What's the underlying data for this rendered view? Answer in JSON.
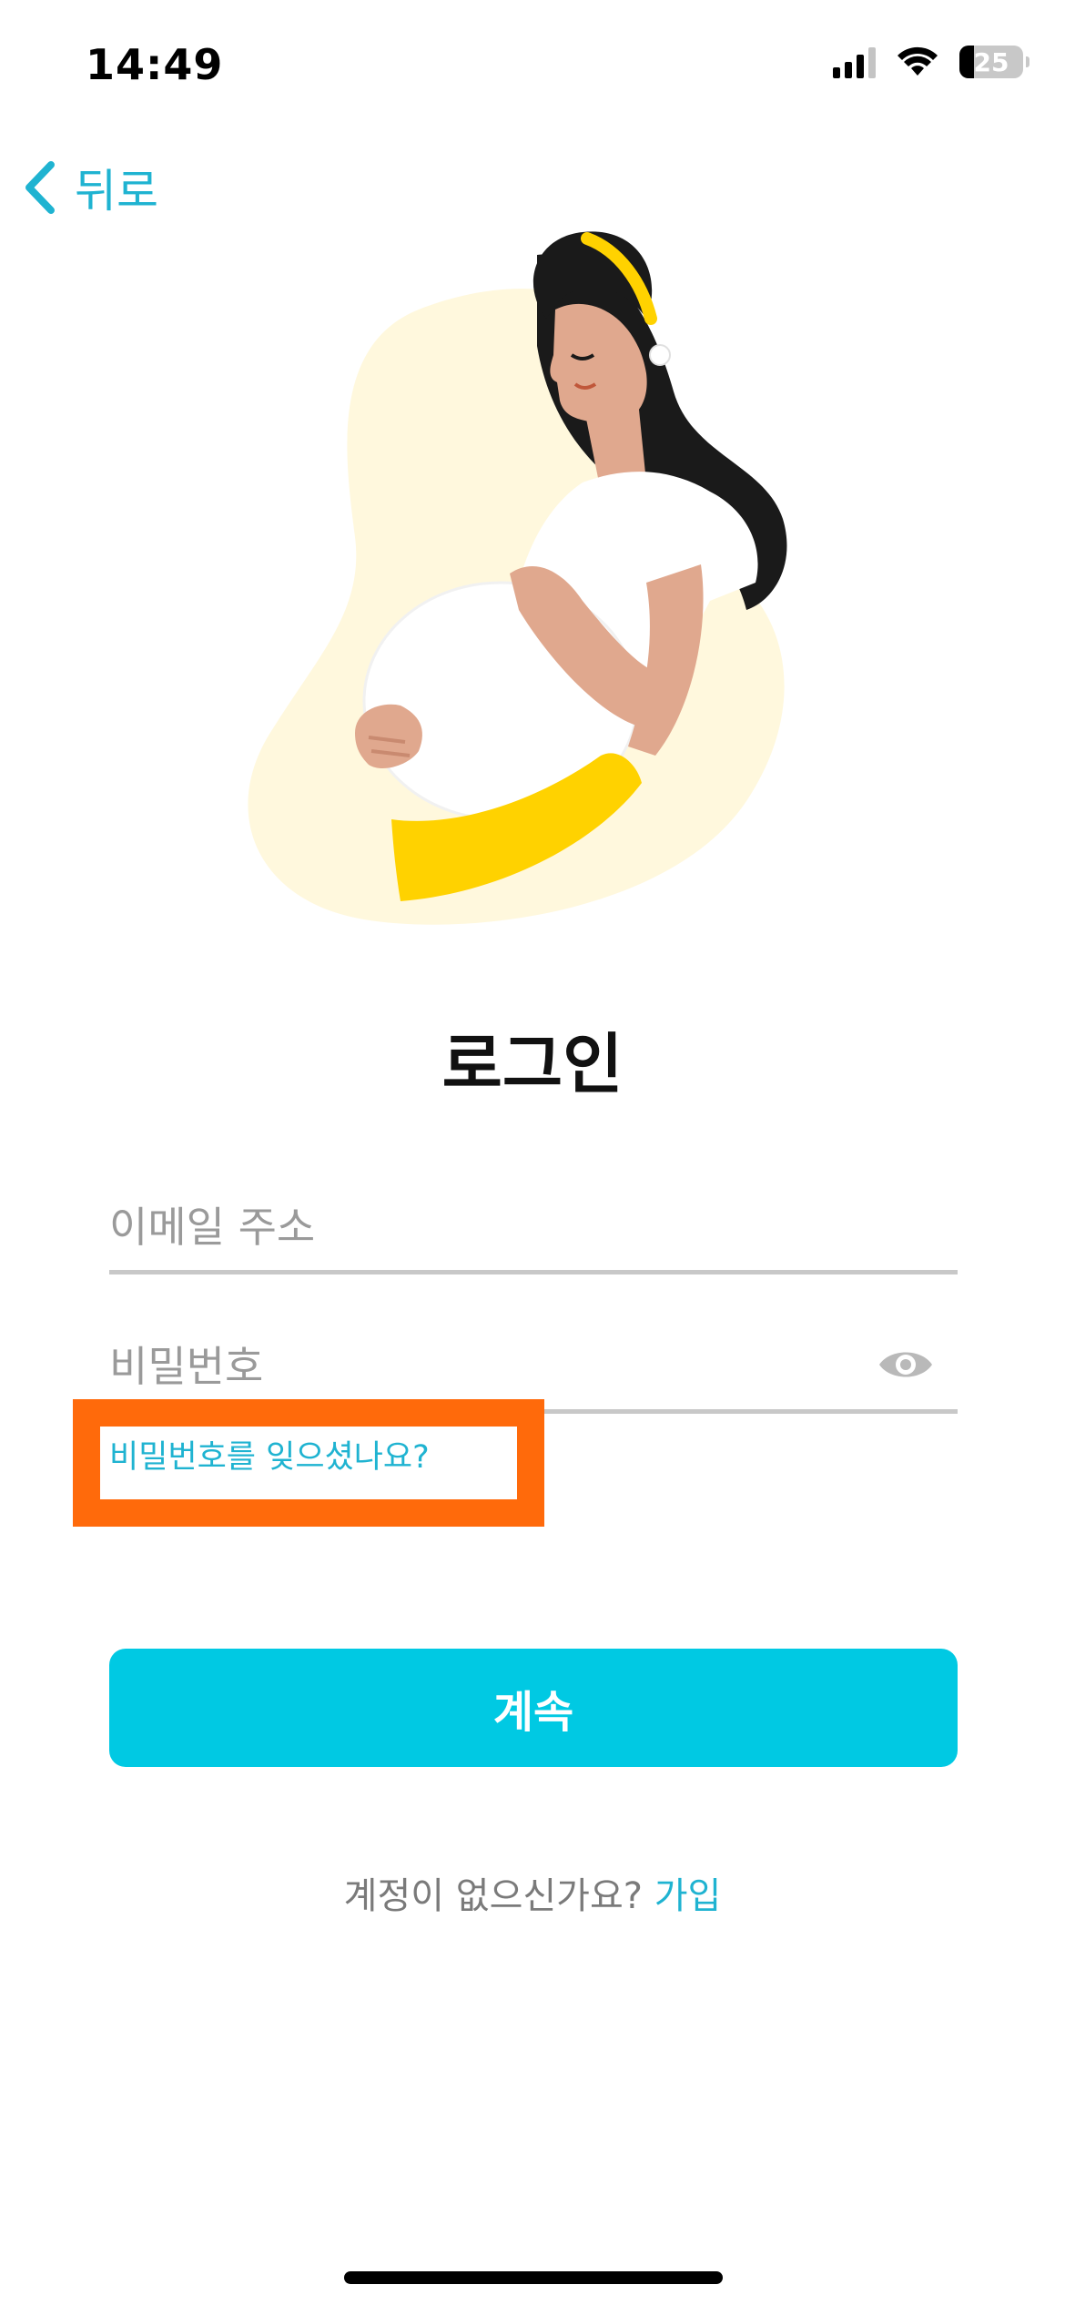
{
  "status_bar": {
    "time": "14:49",
    "battery_level": "25",
    "icons": [
      "cellular-signal-icon",
      "wifi-icon",
      "battery-icon"
    ]
  },
  "nav": {
    "back_label": "뒤로",
    "back_icon": "chevron-left-icon"
  },
  "illustration": {
    "icon": "pregnant-woman-illustration"
  },
  "login": {
    "title": "로그인",
    "email_placeholder": "이메일 주소",
    "password_placeholder": "비밀번호",
    "password_toggle_icon": "eye-icon",
    "forgot_password": "비밀번호를 잊으셨나요?",
    "continue_label": "계속"
  },
  "signup": {
    "prompt": "계정이 없으신가요?",
    "link": "가입"
  },
  "colors": {
    "accent": "#00c9e3",
    "link": "#1fb3d1",
    "highlight": "#ff6a0b",
    "blob": "#fff9e1",
    "yellow": "#ffd200",
    "skin": "#e0a88e",
    "hair": "#1a1a1a"
  }
}
